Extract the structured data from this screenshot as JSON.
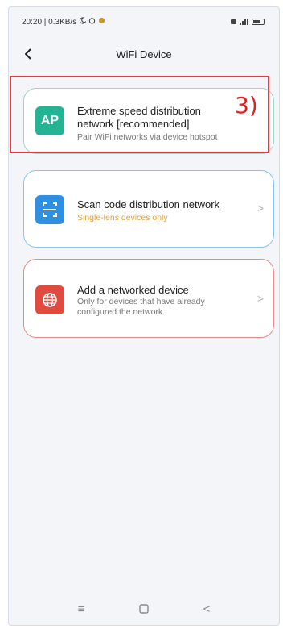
{
  "status_bar": {
    "time_net": "20:20 | 0.3KB/s",
    "icons": [
      "moon-icon",
      "alarm-icon",
      "app-icon",
      "sim-icon",
      "signal-icon",
      "battery-icon"
    ]
  },
  "header": {
    "title": "WiFi Device"
  },
  "cards": [
    {
      "icon_text": "AP",
      "title": "Extreme speed distribution network [recommended]",
      "subtitle": "Pair WiFi networks via device hotspot",
      "accent": "#26b394"
    },
    {
      "title": "Scan code distribution network",
      "subtitle": "Single-lens devices only",
      "accent": "#2f8fe0"
    },
    {
      "title": "Add a networked device",
      "subtitle": "Only for devices that have already configured the network",
      "accent": "#e04a3f"
    }
  ],
  "annotation": {
    "label": "3)",
    "color": "#e23b3b"
  },
  "chevron": ">",
  "navbar": {
    "menu": "≡",
    "back": "<"
  }
}
